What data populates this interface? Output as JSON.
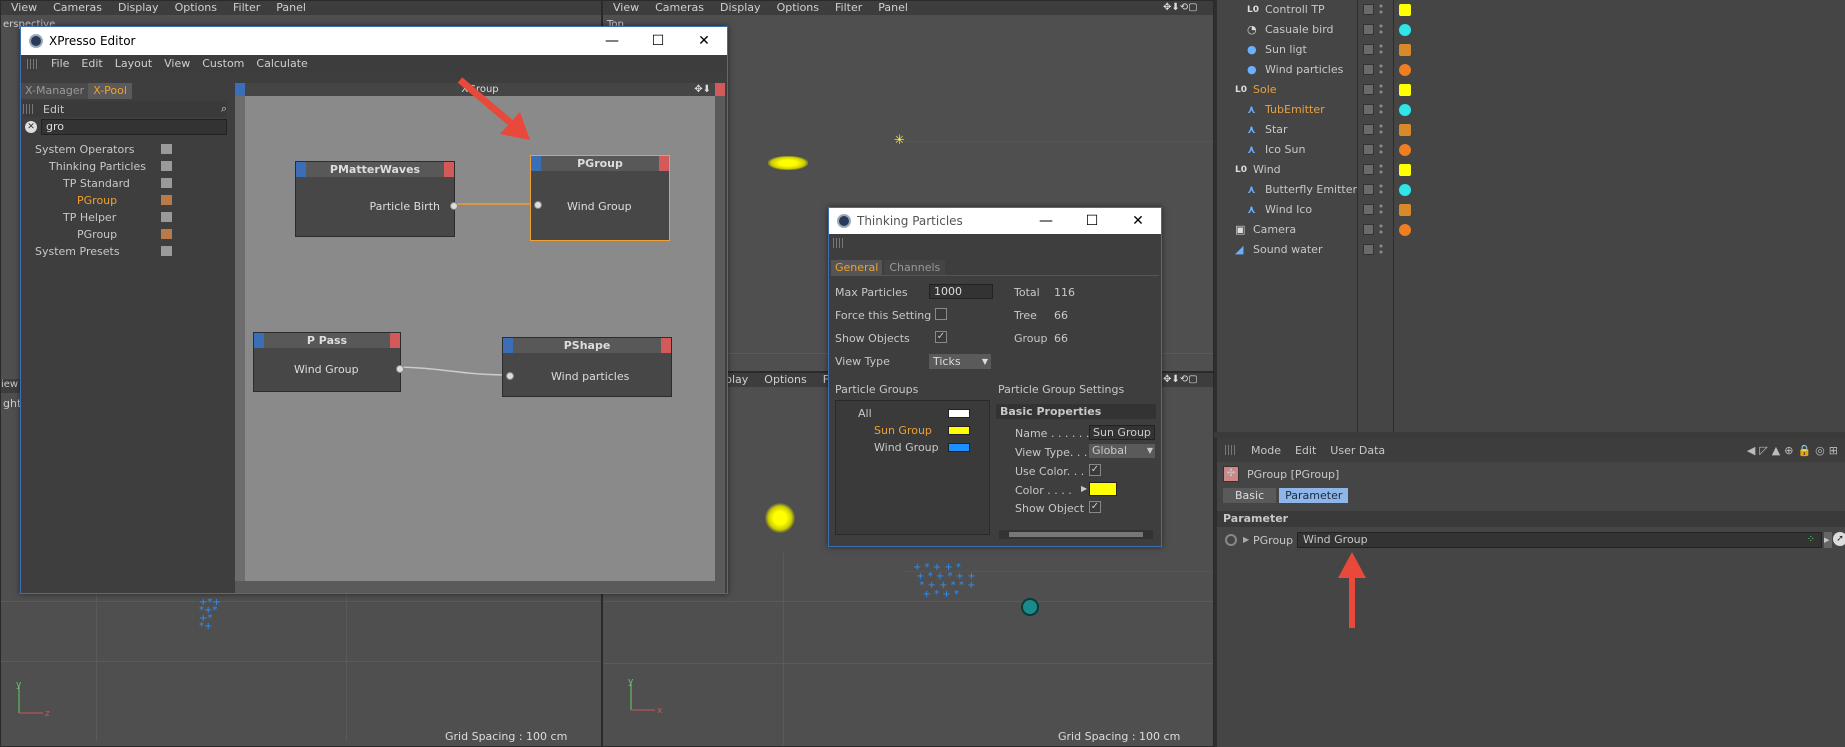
{
  "viewport_menus": {
    "left": [
      "View",
      "Cameras",
      "Display",
      "Options",
      "Filter",
      "Panel"
    ],
    "top_right": [
      "View",
      "Cameras",
      "Display",
      "Options",
      "Filter",
      "Panel"
    ],
    "bottom_right_partial": [
      "play",
      "Options",
      "Filt"
    ]
  },
  "viewport_labels": {
    "perspective": "erspective",
    "top": "Top",
    "right": "ght",
    "camera_partial": "m"
  },
  "grid_spacing": "Grid Spacing : 100 cm",
  "xpresso": {
    "title": "XPresso Editor",
    "menu": [
      "File",
      "Edit",
      "Layout",
      "View",
      "Custom",
      "Calculate"
    ],
    "tabs": [
      "X-Manager",
      "X-Pool"
    ],
    "edit_label": "Edit",
    "search_value": "gro",
    "tree": [
      {
        "label": "System Operators",
        "indent": 0
      },
      {
        "label": "Thinking Particles",
        "indent": 1
      },
      {
        "label": "TP Standard",
        "indent": 2
      },
      {
        "label": "PGroup",
        "indent": 3,
        "active": true
      },
      {
        "label": "TP Helper",
        "indent": 2
      },
      {
        "label": "PGroup",
        "indent": 3
      },
      {
        "label": "System Presets",
        "indent": 0
      }
    ],
    "canvas_title": "XGroup",
    "nodes": {
      "pmatter": {
        "title": "PMatterWaves",
        "port": "Particle Birth"
      },
      "pgroup": {
        "title": "PGroup",
        "port": "Wind Group"
      },
      "ppass": {
        "title": "P Pass",
        "port": "Wind Group"
      },
      "pshape": {
        "title": "PShape",
        "port": "Wind particles"
      }
    }
  },
  "tp": {
    "title": "Thinking Particles",
    "tabs": [
      "General",
      "Channels"
    ],
    "max_particles_label": "Max Particles",
    "max_particles": "1000",
    "force_label": "Force this Setting",
    "show_objects_label": "Show Objects",
    "view_type_label": "View Type",
    "view_type": "Ticks",
    "total_label": "Total",
    "total": "116",
    "tree_label": "Tree",
    "tree": "66",
    "group_label": "Group",
    "group": "66",
    "groups_header": "Particle Groups",
    "settings_header": "Particle Group Settings",
    "groups": [
      {
        "name": "All",
        "color": "#ffffff"
      },
      {
        "name": "Sun Group",
        "color": "#ffff00",
        "active": true
      },
      {
        "name": "Wind Group",
        "color": "#1e8fff"
      }
    ],
    "basic_props": "Basic Properties",
    "name_label": "Name . . . . . .",
    "name_value": "Sun Group",
    "viewtype_label": "View Type. . .",
    "viewtype_value": "Global",
    "usecolor_label": "Use Color. . .",
    "color_label": "Color . . . .",
    "color_value": "#ffff00",
    "showobj_label": "Show Object"
  },
  "objects": [
    {
      "name": "Controll TP",
      "indent": 1,
      "type": "L0"
    },
    {
      "name": "Casuale bird",
      "indent": 1,
      "type": "obj"
    },
    {
      "name": "Sun ligt",
      "indent": 1,
      "type": "sphere"
    },
    {
      "name": "Wind particles",
      "indent": 1,
      "type": "sphere"
    },
    {
      "name": "Sole",
      "indent": 0,
      "type": "L0",
      "color": "#e8a040"
    },
    {
      "name": "TubEmitter",
      "indent": 1,
      "type": "emitter",
      "color": "#e8a040"
    },
    {
      "name": "Star",
      "indent": 1,
      "type": "emitter"
    },
    {
      "name": "Ico Sun",
      "indent": 1,
      "type": "emitter"
    },
    {
      "name": "Wind",
      "indent": 0,
      "type": "L0"
    },
    {
      "name": "Butterfly Emitter",
      "indent": 1,
      "type": "emitter"
    },
    {
      "name": "Wind Ico",
      "indent": 1,
      "type": "emitter"
    },
    {
      "name": "Camera",
      "indent": 0,
      "type": "camera"
    },
    {
      "name": "Sound water",
      "indent": 0,
      "type": "sound"
    }
  ],
  "attr": {
    "menu": [
      "Mode",
      "Edit",
      "User Data"
    ],
    "object_title": "PGroup [PGroup]",
    "tabs": [
      "Basic",
      "Parameter"
    ],
    "section": "Parameter",
    "param_label": "PGroup",
    "param_value": "Wind Group"
  },
  "colors": {
    "accent": "#f0a030",
    "arrow": "#e8493a",
    "blue_axis": "#3a3aff",
    "red_axis": "#cc2222"
  }
}
